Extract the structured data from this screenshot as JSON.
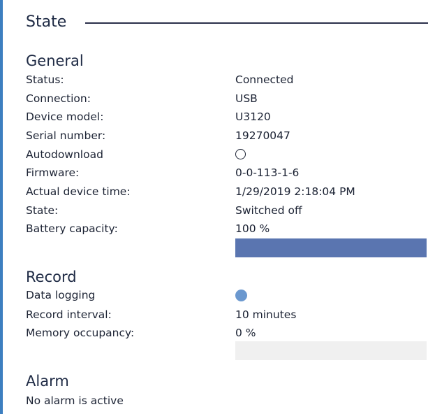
{
  "state": {
    "title": "State",
    "general": {
      "heading": "General",
      "status_label": "Status:",
      "status_value": "Connected",
      "connection_label": "Connection:",
      "connection_value": "USB",
      "device_model_label": "Device model:",
      "device_model_value": "U3120",
      "serial_label": "Serial number:",
      "serial_value": "19270047",
      "autodownload_label": "Autodownload",
      "autodownload_enabled": false,
      "firmware_label": "Firmware:",
      "firmware_value": "0-0-113-1-6",
      "time_label": "Actual device time:",
      "time_value": "1/29/2019 2:18:04 PM",
      "state_label": "State:",
      "state_value": "Switched off",
      "battery_label": "Battery capacity:",
      "battery_value": "100 %",
      "battery_percent": 100
    },
    "record": {
      "heading": "Record",
      "logging_label": "Data logging",
      "logging_enabled": true,
      "interval_label": "Record interval:",
      "interval_value": "10 minutes",
      "memory_label": "Memory occupancy:",
      "memory_value": "0 %",
      "memory_percent": 0
    },
    "alarm": {
      "heading": "Alarm",
      "status_text": "No alarm is active"
    }
  },
  "colors": {
    "accent_border": "#3d7fc0",
    "bar_fill": "#5a75b0",
    "bar_track": "#f0f0f0",
    "indicator_on": "#6b98cf"
  }
}
